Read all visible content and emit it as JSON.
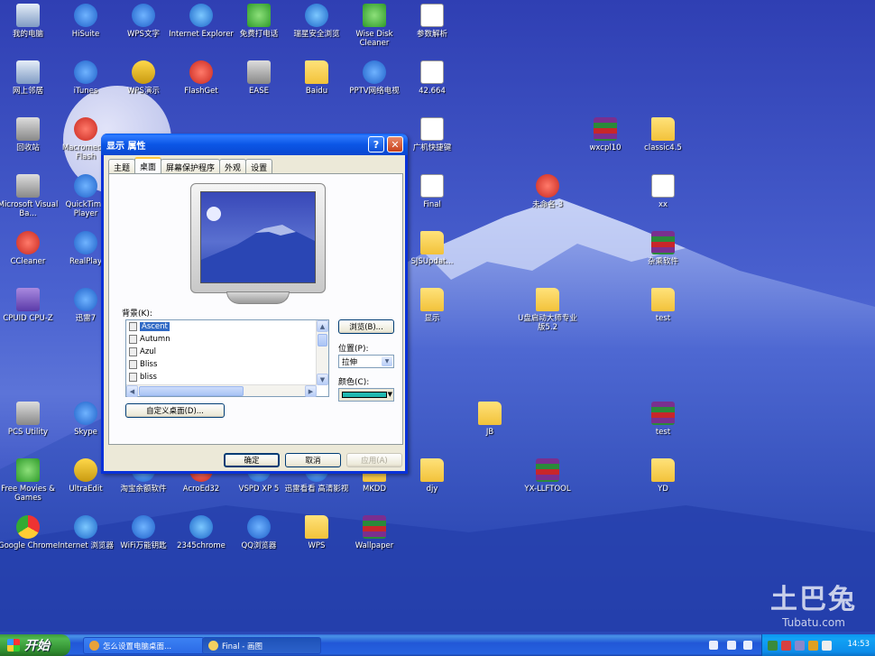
{
  "desktop": {
    "icons": [
      {
        "label": "我的电脑",
        "icon": "computer-icon",
        "kind": "pc"
      },
      {
        "label": "HiSuite",
        "icon": "hisuite-icon",
        "kind": "blue"
      },
      {
        "label": "WPS文字",
        "icon": "wps-writer-icon",
        "kind": "blue"
      },
      {
        "label": "Internet Explorer",
        "icon": "ie-icon",
        "kind": "ie"
      },
      {
        "label": "免费打电话",
        "icon": "phone-icon",
        "kind": "green"
      },
      {
        "label": "瑞星安全浏览",
        "icon": "browser-icon",
        "kind": "ie"
      },
      {
        "label": "Wise Disk Cleaner",
        "icon": "disk-cleaner-icon",
        "kind": "green"
      },
      {
        "label": "参数解析",
        "icon": "word-doc-icon",
        "kind": "doc"
      },
      {
        "label": "网上邻居",
        "icon": "network-icon",
        "kind": "pc"
      },
      {
        "label": "iTunes",
        "icon": "itunes-icon",
        "kind": "blue"
      },
      {
        "label": "WPS演示",
        "icon": "wps-ppt-icon",
        "kind": "yellow"
      },
      {
        "label": "FlashGet",
        "icon": "flashget-icon",
        "kind": "red"
      },
      {
        "label": "EASE",
        "icon": "flag-icon",
        "kind": "gray"
      },
      {
        "label": "Baidu",
        "icon": "folder-icon",
        "kind": "folder"
      },
      {
        "label": "PPTV网络电视",
        "icon": "pptv-icon",
        "kind": "blue"
      },
      {
        "label": "42.664",
        "icon": "file-icon",
        "kind": "doc"
      },
      {
        "label": "回收站",
        "icon": "recycle-bin-icon",
        "kind": "gray"
      },
      {
        "label": "Macromedia Flash",
        "icon": "flash-icon",
        "kind": "red"
      },
      {
        "label": "广机快捷键",
        "icon": "file-icon",
        "kind": "doc"
      },
      {
        "label": "wxcpl10",
        "icon": "rar-icon",
        "kind": "rar"
      },
      {
        "label": "classic4.5",
        "icon": "folder-icon",
        "kind": "folder"
      },
      {
        "label": "Microsoft Visual Ba...",
        "icon": "vb-icon",
        "kind": "gray"
      },
      {
        "label": "QuickTime Player",
        "icon": "quicktime-icon",
        "kind": "blue"
      },
      {
        "label": "Final",
        "icon": "file-icon",
        "kind": "doc"
      },
      {
        "label": "未命名-3",
        "icon": "image-file-icon",
        "kind": "red"
      },
      {
        "label": "xx",
        "icon": "file-icon",
        "kind": "doc"
      },
      {
        "label": "CCleaner",
        "icon": "ccleaner-icon",
        "kind": "red"
      },
      {
        "label": "RealPlay",
        "icon": "realplayer-icon",
        "kind": "blue"
      },
      {
        "label": "SJSUpdat...",
        "icon": "folder-icon",
        "kind": "folder"
      },
      {
        "label": "杂乘软件",
        "icon": "rar-icon",
        "kind": "rar"
      },
      {
        "label": "CPUID CPU-Z",
        "icon": "cpuz-icon",
        "kind": "purple"
      },
      {
        "label": "迅雷7",
        "icon": "thunder-icon",
        "kind": "blue"
      },
      {
        "label": "显示",
        "icon": "folder-icon",
        "kind": "folder"
      },
      {
        "label": "U盘启动大师专业版5.2",
        "icon": "folder-icon",
        "kind": "folder"
      },
      {
        "label": "test",
        "icon": "folder-icon",
        "kind": "folder"
      },
      {
        "label": "PCS Utility",
        "icon": "pcs-icon",
        "kind": "gray"
      },
      {
        "label": "Skype",
        "icon": "skype-icon",
        "kind": "blue"
      },
      {
        "label": "JB",
        "icon": "folder-icon",
        "kind": "folder"
      },
      {
        "label": "test",
        "icon": "rar-icon",
        "kind": "rar"
      },
      {
        "label": "Free Movies & Games",
        "icon": "gift-icon",
        "kind": "green"
      },
      {
        "label": "UltraEdit",
        "icon": "ultraedit-icon",
        "kind": "yellow"
      },
      {
        "label": "淘宝余额软件",
        "icon": "app-icon",
        "kind": "blue"
      },
      {
        "label": "AcroEd32",
        "icon": "acrobat-icon",
        "kind": "red"
      },
      {
        "label": "VSPD XP 5",
        "icon": "vspd-icon",
        "kind": "blue"
      },
      {
        "label": "迅雷看看 高清影视",
        "icon": "video-icon",
        "kind": "blue"
      },
      {
        "label": "MKDD",
        "icon": "folder-icon",
        "kind": "folder"
      },
      {
        "label": "djy",
        "icon": "folder-icon",
        "kind": "folder"
      },
      {
        "label": "YX-LLFTOOL",
        "icon": "rar-icon",
        "kind": "rar"
      },
      {
        "label": "YD",
        "icon": "folder-icon",
        "kind": "folder"
      },
      {
        "label": "Google Chrome",
        "icon": "chrome-icon",
        "kind": "chrome"
      },
      {
        "label": "Internet 浏览器",
        "icon": "ie-icon",
        "kind": "ie"
      },
      {
        "label": "WiFi万能钥匙",
        "icon": "wifi-icon",
        "kind": "blue"
      },
      {
        "label": "2345chrome",
        "icon": "ie-icon",
        "kind": "ie"
      },
      {
        "label": "QQ浏览器",
        "icon": "qq-browser-icon",
        "kind": "blue"
      },
      {
        "label": "WPS",
        "icon": "folder-icon",
        "kind": "folder"
      },
      {
        "label": "Wallpaper",
        "icon": "rar-icon",
        "kind": "rar"
      }
    ],
    "watermark": {
      "main": "土巴兔",
      "sub": "Tubatu.com"
    }
  },
  "dialog": {
    "title": "显示 属性",
    "tabs": [
      "主题",
      "桌面",
      "屏幕保护程序",
      "外观",
      "设置"
    ],
    "active_tab": 1,
    "background_label": "背景(K):",
    "backgrounds": [
      "Ascent",
      "Autumn",
      "Azul",
      "Bliss",
      "bliss"
    ],
    "selected_background": 0,
    "browse_button": "浏览(B)...",
    "position_label": "位置(P):",
    "position_value": "拉伸",
    "color_label": "颜色(C):",
    "color_value": "#1fb8b0",
    "customize_button": "自定义桌面(D)...",
    "ok_button": "确定",
    "cancel_button": "取消",
    "apply_button": "应用(A)"
  },
  "taskbar": {
    "start_label": "开始",
    "tasks": [
      {
        "label": "怎么设置电脑桌面...",
        "icon": "chrome-icon",
        "color": "#e8a23a"
      },
      {
        "label": "Final - 画图",
        "icon": "paint-icon",
        "color": "#f4d060"
      }
    ],
    "active_task": 1,
    "clock": "14:53"
  }
}
